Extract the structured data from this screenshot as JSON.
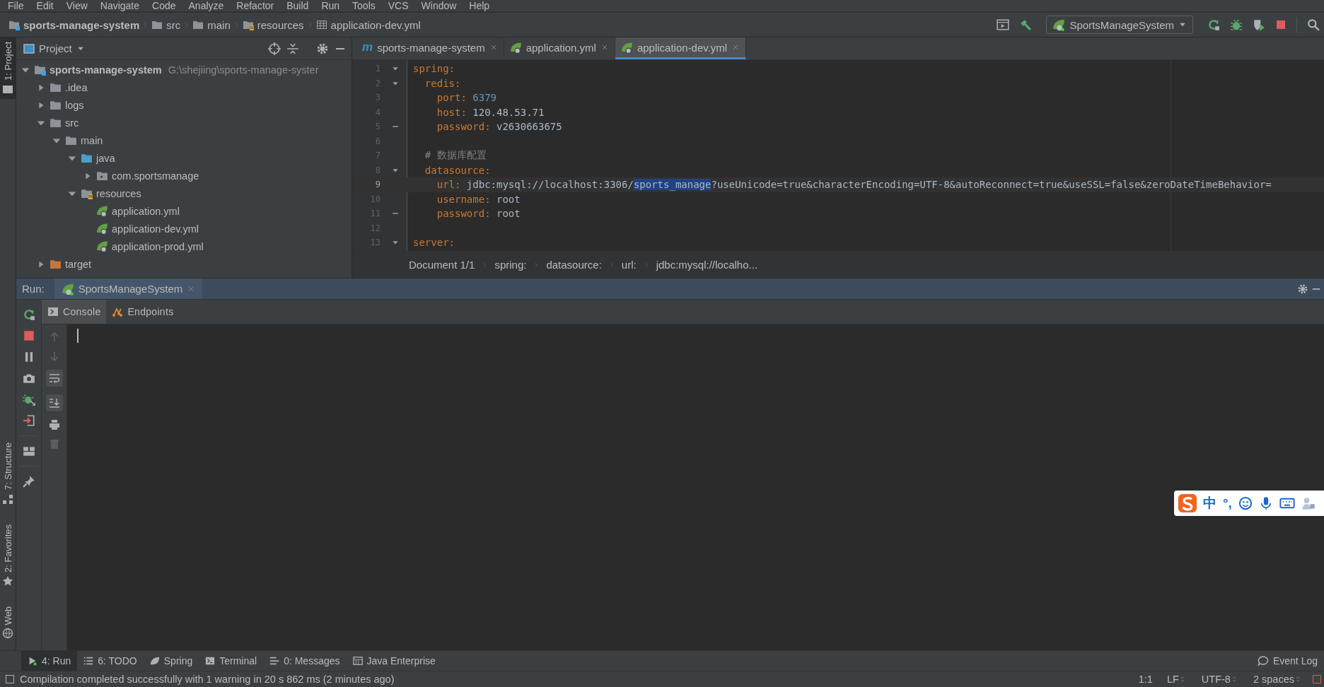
{
  "menu": [
    "File",
    "Edit",
    "View",
    "Navigate",
    "Code",
    "Analyze",
    "Refactor",
    "Build",
    "Run",
    "Tools",
    "VCS",
    "Window",
    "Help"
  ],
  "navbar": {
    "crumbs": [
      {
        "kind": "module",
        "label": "sports-manage-system"
      },
      {
        "kind": "folder",
        "label": "src"
      },
      {
        "kind": "folder",
        "label": "main"
      },
      {
        "kind": "resources",
        "label": "resources"
      },
      {
        "kind": "yml",
        "label": "application-dev.yml"
      }
    ],
    "run_config": "SportsManageSystem"
  },
  "side_strip": {
    "top": [
      {
        "label": "1: Project",
        "selected": true
      }
    ],
    "bottom": [
      {
        "kind": "structure",
        "label": "7: Structure",
        "selected": false
      },
      {
        "kind": "favorites",
        "label": "2: Favorites",
        "selected": false
      },
      {
        "kind": "web",
        "label": "Web",
        "selected": false
      }
    ]
  },
  "project": {
    "title": "Project",
    "tree": [
      {
        "kind": "module",
        "label": "sports-manage-system",
        "path": "G:\\shejiing\\sports-manage-syster",
        "expanded": true,
        "children": [
          {
            "kind": "folder",
            "label": ".idea",
            "expanded": false
          },
          {
            "kind": "folder",
            "label": "logs",
            "expanded": false
          },
          {
            "kind": "folder",
            "label": "src",
            "expanded": true,
            "children": [
              {
                "kind": "folder",
                "label": "main",
                "expanded": true,
                "children": [
                  {
                    "kind": "source",
                    "label": "java",
                    "expanded": true,
                    "children": [
                      {
                        "kind": "package",
                        "label": "com.sportsmanage",
                        "expanded": false
                      }
                    ]
                  },
                  {
                    "kind": "resources",
                    "label": "resources",
                    "expanded": true,
                    "children": [
                      {
                        "kind": "spring",
                        "label": "application.yml"
                      },
                      {
                        "kind": "spring",
                        "label": "application-dev.yml"
                      },
                      {
                        "kind": "spring",
                        "label": "application-prod.yml"
                      }
                    ]
                  }
                ]
              }
            ]
          },
          {
            "kind": "excluded",
            "label": "target",
            "expanded": false
          }
        ]
      }
    ]
  },
  "editor": {
    "tabs": [
      {
        "kind": "maven",
        "icon_char": "m",
        "label": "sports-manage-system",
        "selected": false
      },
      {
        "kind": "spring",
        "label": "application.yml",
        "selected": false
      },
      {
        "kind": "spring",
        "label": "application-dev.yml",
        "selected": true
      }
    ],
    "lines": [
      {
        "number": "1",
        "current": false,
        "fold_start": true,
        "parts": [
          {
            "kind": "key",
            "text": "spring:"
          }
        ]
      },
      {
        "number": "2",
        "current": false,
        "fold_start": true,
        "parts": [
          {
            "kind": "key",
            "text": "  redis:"
          }
        ]
      },
      {
        "number": "3",
        "current": false,
        "parts": [
          {
            "kind": "key",
            "text": "    port:"
          },
          {
            "kind": "number",
            "text": "6379"
          }
        ]
      },
      {
        "number": "4",
        "current": false,
        "parts": [
          {
            "kind": "key",
            "text": "    host:"
          },
          {
            "kind": "string",
            "text": "120.48.53.71"
          }
        ]
      },
      {
        "number": "5",
        "current": false,
        "fold_end": true,
        "parts": [
          {
            "kind": "key",
            "text": "    password:"
          },
          {
            "kind": "string",
            "text": "v2630663675"
          }
        ]
      },
      {
        "number": "6",
        "current": false
      },
      {
        "number": "7",
        "current": false,
        "parts": [
          {
            "kind": "comment",
            "text": "  # 数据库配置"
          }
        ]
      },
      {
        "number": "8",
        "current": false,
        "fold_start": true,
        "parts": [
          {
            "kind": "key",
            "text": "  datasource:"
          }
        ]
      },
      {
        "number": "9",
        "current": true,
        "parts": [
          {
            "kind": "key",
            "text": "    url:"
          },
          {
            "kind": "string",
            "text": "jdbc:mysql://localhost:3306/"
          },
          {
            "kind": "selection",
            "text": "sports_manage"
          },
          {
            "kind": "string",
            "text": "?useUnicode=true&characterEncoding=UTF-8&autoReconnect=true&useSSL=false&zeroDateTimeBehavior="
          }
        ]
      },
      {
        "number": "10",
        "current": false,
        "parts": [
          {
            "kind": "key",
            "text": "    username:"
          },
          {
            "kind": "string",
            "text": "root"
          }
        ]
      },
      {
        "number": "11",
        "current": false,
        "fold_end": true,
        "parts": [
          {
            "kind": "key",
            "text": "    password:"
          },
          {
            "kind": "string",
            "text": "root"
          }
        ]
      },
      {
        "number": "12",
        "current": false
      },
      {
        "number": "13",
        "current": false,
        "fold_start": true,
        "parts": [
          {
            "kind": "key",
            "text": "server:"
          }
        ]
      }
    ],
    "breadcrumbs": [
      "Document 1/1",
      "spring:",
      "datasource:",
      "url:",
      "jdbc:mysql://localho..."
    ]
  },
  "run": {
    "label": "Run:",
    "tab": "SportsManageSystem",
    "subtabs": [
      {
        "kind": "console",
        "label": "Console",
        "selected": true
      },
      {
        "kind": "endpoints",
        "label": "Endpoints",
        "selected": false
      }
    ]
  },
  "bottom_tabs": [
    {
      "kind": "run",
      "label": "4: Run",
      "selected": true
    },
    {
      "kind": "todo",
      "label": "6: TODO",
      "selected": false
    },
    {
      "kind": "spring",
      "label": "Spring",
      "selected": false
    },
    {
      "kind": "terminal",
      "label": "Terminal",
      "selected": false
    },
    {
      "kind": "messages",
      "label": "0: Messages",
      "selected": false
    },
    {
      "kind": "javaee",
      "label": "Java Enterprise",
      "selected": false
    }
  ],
  "event_log": "Event Log",
  "status_bar": {
    "message": "Compilation completed successfully with 1 warning in 20 s 862 ms (2 minutes ago)",
    "position": "1:1",
    "line_separator": "LF",
    "encoding": "UTF-8",
    "indent": "2 spaces"
  },
  "ime": {
    "mode": "中",
    "punctuation": "°,"
  }
}
